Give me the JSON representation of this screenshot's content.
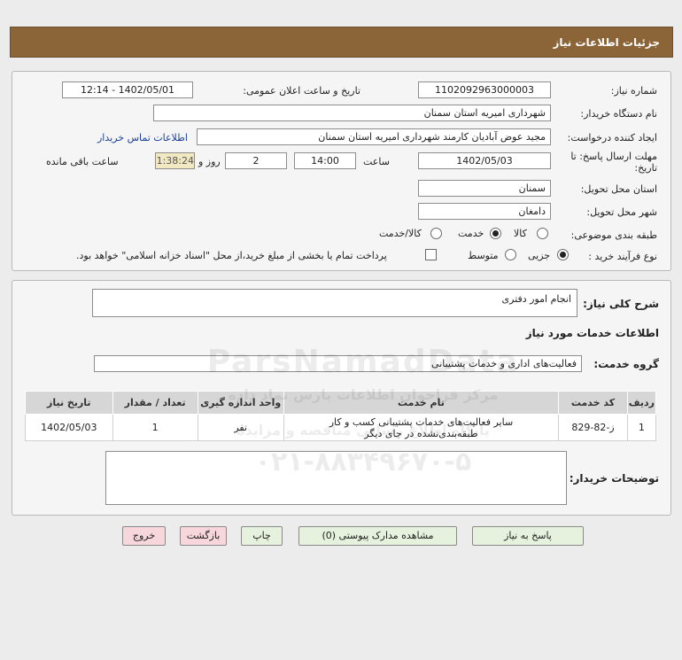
{
  "header": {
    "title": "جزئیات اطلاعات نیاز"
  },
  "form": {
    "need_number_label": "شماره نیاز:",
    "need_number": "1102092963000003",
    "announce_label": "تاریخ و ساعت اعلان عمومی:",
    "announce_value": "1402/05/01 - 12:14",
    "buyer_org_label": "نام دستگاه خریدار:",
    "buyer_org": "شهرداری امیریه استان سمنان",
    "requester_label": "ایجاد کننده درخواست:",
    "requester": "مجید عوض آبادیان کارمند شهرداری امیریه استان سمنان",
    "contact_link": "اطلاعات تماس خریدار",
    "deadline_label_1": "مهلت ارسال پاسخ: تا",
    "deadline_label_2": "تاریخ:",
    "deadline_date": "1402/05/03",
    "time_label": "ساعت",
    "deadline_time": "14:00",
    "days_value": "2",
    "days_label": "روز و",
    "remaining_time": "01:38:24",
    "remaining_label": "ساعت باقی مانده",
    "province_label": "استان محل تحویل:",
    "province": "سمنان",
    "city_label": "شهر محل تحویل:",
    "city": "دامغان",
    "category_label": "طبقه بندی موضوعی:",
    "category_options": [
      "کالا",
      "خدمت",
      "کالا/خدمت"
    ],
    "category_selected": "خدمت",
    "process_label": "نوع فرآیند خرید :",
    "process_options": [
      "جزیی",
      "متوسط"
    ],
    "process_selected": "جزیی",
    "payment_note": "پرداخت تمام یا بخشی از مبلغ خرید،از محل \"اسناد خزانه اسلامی\" خواهد بود."
  },
  "summary": {
    "description_label": "شرح کلی نیاز:",
    "description": "انجام امور دفتری",
    "services_title": "اطلاعات خدمات مورد نیاز",
    "service_group_label": "گروه خدمت:",
    "service_group": "فعالیت‌های اداری و خدمات پشتیبانی",
    "table": {
      "headers": [
        "ردیف",
        "کد خدمت",
        "نام خدمت",
        "واحد اندازه گیری",
        "تعداد / مقدار",
        "تاریخ نیاز"
      ],
      "rows": [
        {
          "row": "1",
          "code": "ز-82-829",
          "name_line1": "سایر فعالیت‌های خدمات پشتیبانی کسب و کار",
          "name_line2": "طبقه‌بندی‌نشده در جای دیگر",
          "unit": "نفر",
          "qty": "1",
          "date": "1402/05/03"
        }
      ]
    },
    "buyer_notes_label": "توضیحات خریدار:",
    "buyer_notes": ""
  },
  "buttons": {
    "reply": "پاسخ به نیاز",
    "view_docs": "مشاهده مدارک پیوستی (0)",
    "print": "چاپ",
    "back": "بازگشت",
    "exit": "خروج"
  },
  "watermark": {
    "brand": "ParsNamadData",
    "line1": "مرکز فراخوان اطلاعات پارس نماد داده",
    "line2": "پایگاه اطلاع رسانی مناقصه و مزایده",
    "phone": "۰۲۱-۸۸۳۴۹۶۷۰-۵"
  },
  "colors": {
    "header_bg": "#8b6538",
    "button_green": "#e6f2dd",
    "button_pink": "#f7d6dc"
  }
}
